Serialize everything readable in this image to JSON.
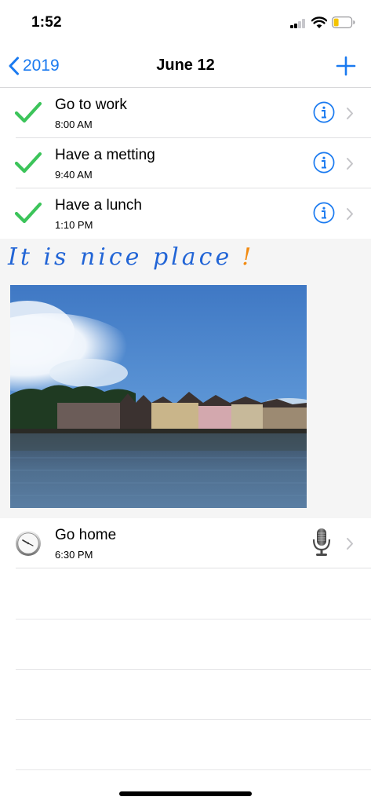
{
  "status_bar": {
    "time": "1:52"
  },
  "nav": {
    "back_label": "2019",
    "title": "June 12"
  },
  "tasks": [
    {
      "title": "Go to work",
      "time": "8:00 AM",
      "status": "done"
    },
    {
      "title": "Have a metting",
      "time": "9:40 AM",
      "status": "done"
    },
    {
      "title": "Have a lunch",
      "time": "1:10 PM",
      "status": "done"
    }
  ],
  "note": {
    "handwriting": "It is nice place",
    "exclamation": "!"
  },
  "upcoming_task": {
    "title": "Go home",
    "time": "6:30 PM",
    "icon": "clock-icon",
    "attachment_icon": "microphone-icon"
  },
  "colors": {
    "accent": "#1a7af0",
    "check": "#3cc45a",
    "handwriting": "#2265d6",
    "exclamation": "#f28a10"
  }
}
